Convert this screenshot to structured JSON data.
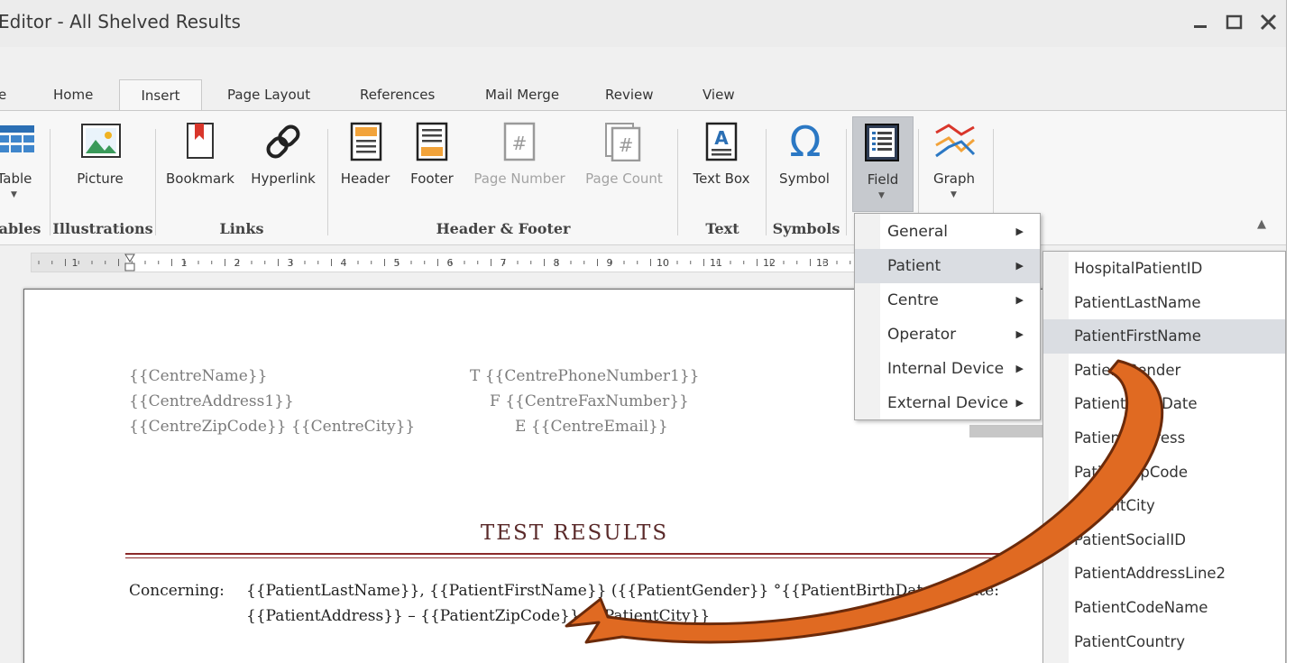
{
  "window": {
    "title": "Editor - All Shelved Results"
  },
  "tabs": [
    "e",
    "Home",
    "Insert",
    "Page Layout",
    "References",
    "Mail Merge",
    "Review",
    "View"
  ],
  "active_tab": "Insert",
  "ribbon": {
    "buttons": {
      "table": "Table",
      "picture": "Picture",
      "bookmark": "Bookmark",
      "hyperlink": "Hyperlink",
      "header": "Header",
      "footer": "Footer",
      "page_number": "Page Number",
      "page_count": "Page Count",
      "text_box": "Text Box",
      "symbol": "Symbol",
      "field": "Field",
      "graph": "Graph"
    },
    "groups": {
      "tables": "ables",
      "illustrations": "Illustrations",
      "links": "Links",
      "header_footer": "Header & Footer",
      "text": "Text",
      "symbols": "Symbols"
    }
  },
  "ruler": {
    "numbers": [
      "1",
      "1",
      "2",
      "3",
      "4",
      "5",
      "6",
      "7",
      "8",
      "9",
      "10",
      "11",
      "12",
      "13"
    ]
  },
  "document": {
    "centre_name": "{{CentreName}}",
    "centre_address": "{{CentreAddress1}}",
    "centre_zip_city": "{{CentreZipCode}} {{CentreCity}}",
    "phone": "T {{CentrePhoneNumber1}}",
    "fax": "F {{CentreFaxNumber}}",
    "email": "E {{CentreEmail}}",
    "heading": "TEST RESULTS",
    "concerning_label": "Concerning:",
    "concerning_line1": "{{PatientLastName}}, {{PatientFirstName}} ({{PatientGender}} °{{PatientBirthDate}})Date:",
    "concerning_line2": "{{PatientAddress}} – {{PatientZipCode}} {{PatientCity}}"
  },
  "field_menu": {
    "items": [
      "General",
      "Patient",
      "Centre",
      "Operator",
      "Internal Device",
      "External Device"
    ],
    "highlighted": "Patient"
  },
  "patient_submenu": {
    "items": [
      "HospitalPatientID",
      "PatientLastName",
      "PatientFirstName",
      "PatientGender",
      "PatientBirthDate",
      "PatientAddress",
      "PatientZipCode",
      "PatientCity",
      "PatientSocialID",
      "PatientAddressLine2",
      "PatientCodeName",
      "PatientCountry"
    ],
    "highlighted": "PatientFirstName"
  },
  "colors": {
    "accent_blue": "#2b78c4",
    "arrow_fill": "#e06a22",
    "arrow_stroke": "#6b2a0a",
    "heading_rule": "#8b2a2a"
  }
}
